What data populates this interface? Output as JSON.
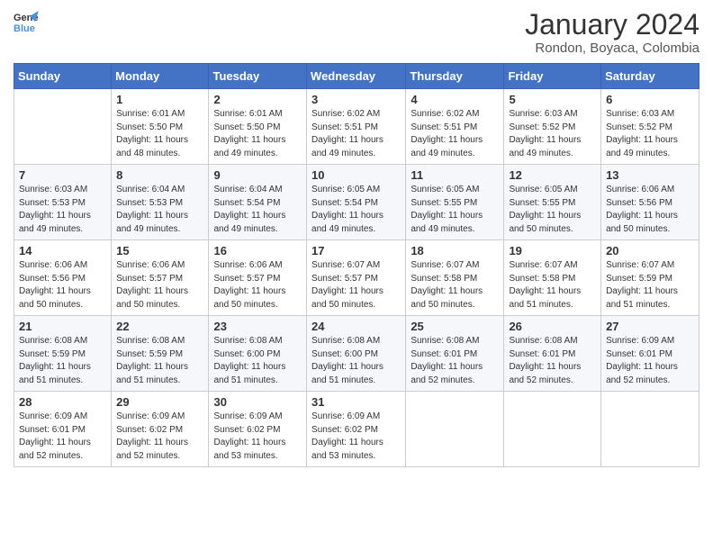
{
  "logo": {
    "line1": "General",
    "line2": "Blue"
  },
  "title": "January 2024",
  "subtitle": "Rondon, Boyaca, Colombia",
  "header": {
    "days": [
      "Sunday",
      "Monday",
      "Tuesday",
      "Wednesday",
      "Thursday",
      "Friday",
      "Saturday"
    ]
  },
  "weeks": [
    [
      {
        "day": "",
        "info": ""
      },
      {
        "day": "1",
        "info": "Sunrise: 6:01 AM\nSunset: 5:50 PM\nDaylight: 11 hours\nand 48 minutes."
      },
      {
        "day": "2",
        "info": "Sunrise: 6:01 AM\nSunset: 5:50 PM\nDaylight: 11 hours\nand 49 minutes."
      },
      {
        "day": "3",
        "info": "Sunrise: 6:02 AM\nSunset: 5:51 PM\nDaylight: 11 hours\nand 49 minutes."
      },
      {
        "day": "4",
        "info": "Sunrise: 6:02 AM\nSunset: 5:51 PM\nDaylight: 11 hours\nand 49 minutes."
      },
      {
        "day": "5",
        "info": "Sunrise: 6:03 AM\nSunset: 5:52 PM\nDaylight: 11 hours\nand 49 minutes."
      },
      {
        "day": "6",
        "info": "Sunrise: 6:03 AM\nSunset: 5:52 PM\nDaylight: 11 hours\nand 49 minutes."
      }
    ],
    [
      {
        "day": "7",
        "info": "Sunrise: 6:03 AM\nSunset: 5:53 PM\nDaylight: 11 hours\nand 49 minutes."
      },
      {
        "day": "8",
        "info": "Sunrise: 6:04 AM\nSunset: 5:53 PM\nDaylight: 11 hours\nand 49 minutes."
      },
      {
        "day": "9",
        "info": "Sunrise: 6:04 AM\nSunset: 5:54 PM\nDaylight: 11 hours\nand 49 minutes."
      },
      {
        "day": "10",
        "info": "Sunrise: 6:05 AM\nSunset: 5:54 PM\nDaylight: 11 hours\nand 49 minutes."
      },
      {
        "day": "11",
        "info": "Sunrise: 6:05 AM\nSunset: 5:55 PM\nDaylight: 11 hours\nand 49 minutes."
      },
      {
        "day": "12",
        "info": "Sunrise: 6:05 AM\nSunset: 5:55 PM\nDaylight: 11 hours\nand 50 minutes."
      },
      {
        "day": "13",
        "info": "Sunrise: 6:06 AM\nSunset: 5:56 PM\nDaylight: 11 hours\nand 50 minutes."
      }
    ],
    [
      {
        "day": "14",
        "info": "Sunrise: 6:06 AM\nSunset: 5:56 PM\nDaylight: 11 hours\nand 50 minutes."
      },
      {
        "day": "15",
        "info": "Sunrise: 6:06 AM\nSunset: 5:57 PM\nDaylight: 11 hours\nand 50 minutes."
      },
      {
        "day": "16",
        "info": "Sunrise: 6:06 AM\nSunset: 5:57 PM\nDaylight: 11 hours\nand 50 minutes."
      },
      {
        "day": "17",
        "info": "Sunrise: 6:07 AM\nSunset: 5:57 PM\nDaylight: 11 hours\nand 50 minutes."
      },
      {
        "day": "18",
        "info": "Sunrise: 6:07 AM\nSunset: 5:58 PM\nDaylight: 11 hours\nand 50 minutes."
      },
      {
        "day": "19",
        "info": "Sunrise: 6:07 AM\nSunset: 5:58 PM\nDaylight: 11 hours\nand 51 minutes."
      },
      {
        "day": "20",
        "info": "Sunrise: 6:07 AM\nSunset: 5:59 PM\nDaylight: 11 hours\nand 51 minutes."
      }
    ],
    [
      {
        "day": "21",
        "info": "Sunrise: 6:08 AM\nSunset: 5:59 PM\nDaylight: 11 hours\nand 51 minutes."
      },
      {
        "day": "22",
        "info": "Sunrise: 6:08 AM\nSunset: 5:59 PM\nDaylight: 11 hours\nand 51 minutes."
      },
      {
        "day": "23",
        "info": "Sunrise: 6:08 AM\nSunset: 6:00 PM\nDaylight: 11 hours\nand 51 minutes."
      },
      {
        "day": "24",
        "info": "Sunrise: 6:08 AM\nSunset: 6:00 PM\nDaylight: 11 hours\nand 51 minutes."
      },
      {
        "day": "25",
        "info": "Sunrise: 6:08 AM\nSunset: 6:01 PM\nDaylight: 11 hours\nand 52 minutes."
      },
      {
        "day": "26",
        "info": "Sunrise: 6:08 AM\nSunset: 6:01 PM\nDaylight: 11 hours\nand 52 minutes."
      },
      {
        "day": "27",
        "info": "Sunrise: 6:09 AM\nSunset: 6:01 PM\nDaylight: 11 hours\nand 52 minutes."
      }
    ],
    [
      {
        "day": "28",
        "info": "Sunrise: 6:09 AM\nSunset: 6:01 PM\nDaylight: 11 hours\nand 52 minutes."
      },
      {
        "day": "29",
        "info": "Sunrise: 6:09 AM\nSunset: 6:02 PM\nDaylight: 11 hours\nand 52 minutes."
      },
      {
        "day": "30",
        "info": "Sunrise: 6:09 AM\nSunset: 6:02 PM\nDaylight: 11 hours\nand 53 minutes."
      },
      {
        "day": "31",
        "info": "Sunrise: 6:09 AM\nSunset: 6:02 PM\nDaylight: 11 hours\nand 53 minutes."
      },
      {
        "day": "",
        "info": ""
      },
      {
        "day": "",
        "info": ""
      },
      {
        "day": "",
        "info": ""
      }
    ]
  ]
}
